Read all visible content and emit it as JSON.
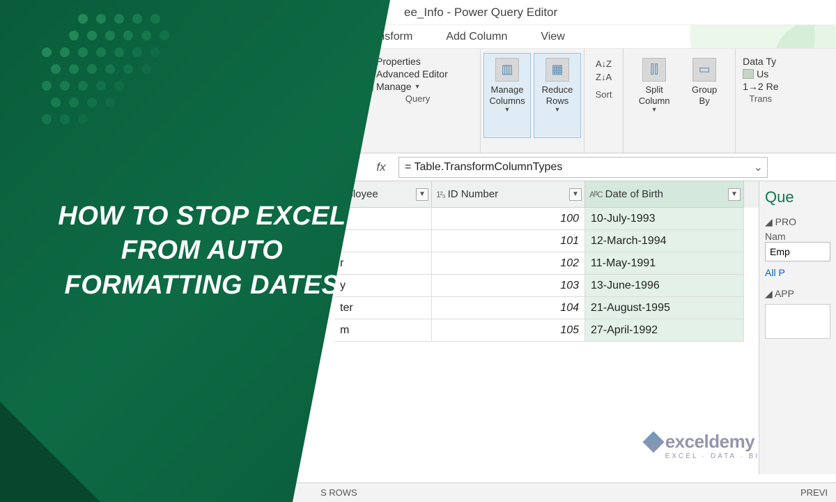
{
  "overlay": {
    "title_l1": "HOW TO STOP EXCEL",
    "title_l2": "FROM AUTO",
    "title_l3": "FORMATTING DATES"
  },
  "window": {
    "title": "ee_Info - Power Query Editor"
  },
  "tabs": {
    "transform": "Transform",
    "addcol": "Add Column",
    "view": "View"
  },
  "ribbon": {
    "query": {
      "properties": "Properties",
      "adv": "Advanced Editor",
      "manage": "Manage",
      "label": "Query"
    },
    "managecols": "Manage\nColumns",
    "reducerows": "Reduce\nRows",
    "sort_asc": "A↓Z",
    "sort_desc": "Z↓A",
    "sort_label": "Sort",
    "split": "Split\nColumn",
    "groupby": "Group\nBy",
    "trans": {
      "datatype": "Data Ty",
      "use": "Us",
      "replace": "1→2 Re",
      "label": "Trans"
    }
  },
  "formula": {
    "label": "fx",
    "value": "= Table.TransformColumnTypes"
  },
  "columns": {
    "c1": {
      "label": "mployee",
      "type": ""
    },
    "c2": {
      "label": "ID Number",
      "type": "1²₃"
    },
    "c3": {
      "label": "Date of Birth",
      "type": "AᴮC"
    }
  },
  "rows": [
    {
      "emp": "",
      "id": "100",
      "dob": "10-July-1993"
    },
    {
      "emp": "",
      "id": "101",
      "dob": "12-March-1994"
    },
    {
      "emp": "r",
      "id": "102",
      "dob": "11-May-1991"
    },
    {
      "emp": "y",
      "id": "103",
      "dob": "13-June-1996"
    },
    {
      "emp": "ter",
      "id": "104",
      "dob": "21-August-1995"
    },
    {
      "emp": "m",
      "id": "105",
      "dob": "27-April-1992"
    }
  ],
  "rightpane": {
    "heading": "Que",
    "sect1": "PRO",
    "namelabel": "Nam",
    "namevalue": "Emp",
    "allp": "All P",
    "sect2": "APP"
  },
  "status": {
    "left": "S ROWS",
    "right": "PREVI"
  },
  "watermark": {
    "brand": "exceldemy",
    "tag": "EXCEL · DATA · BI"
  }
}
